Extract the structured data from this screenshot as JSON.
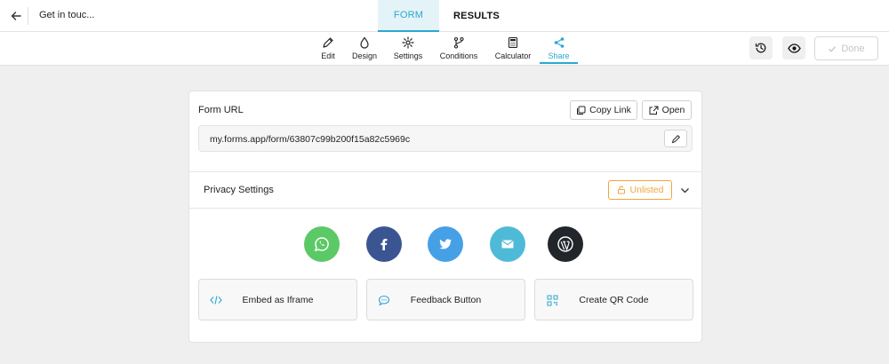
{
  "header": {
    "form_title": "Get in touc...",
    "tabs": [
      {
        "label": "FORM",
        "active": true
      },
      {
        "label": "RESULTS",
        "active": false
      }
    ]
  },
  "toolbar": {
    "items": [
      {
        "label": "Edit",
        "icon": "pencil-icon"
      },
      {
        "label": "Design",
        "icon": "droplet-icon"
      },
      {
        "label": "Settings",
        "icon": "gear-icon"
      },
      {
        "label": "Conditions",
        "icon": "branch-icon"
      },
      {
        "label": "Calculator",
        "icon": "calculator-icon"
      },
      {
        "label": "Share",
        "icon": "share-icon",
        "active": true
      }
    ],
    "done_label": "Done"
  },
  "share": {
    "form_url_title": "Form URL",
    "copy_link_label": "Copy Link",
    "open_label": "Open",
    "url": "my.forms.app/form/63807c99b200f15a82c5969c",
    "privacy_title": "Privacy Settings",
    "privacy_value": "Unlisted",
    "social": [
      {
        "name": "whatsapp",
        "color": "#5bc966"
      },
      {
        "name": "facebook",
        "color": "#3b5593"
      },
      {
        "name": "twitter",
        "color": "#46a0e6"
      },
      {
        "name": "email",
        "color": "#4fbad8"
      },
      {
        "name": "wordpress",
        "color": "#22262b"
      }
    ],
    "actions": [
      {
        "label": "Embed as Iframe",
        "icon": "code-icon"
      },
      {
        "label": "Feedback Button",
        "icon": "chat-bubble-icon"
      },
      {
        "label": "Create QR Code",
        "icon": "qr-code-icon"
      }
    ]
  },
  "colors": {
    "accent": "#2aa8d0",
    "warning": "#f0a63a"
  }
}
